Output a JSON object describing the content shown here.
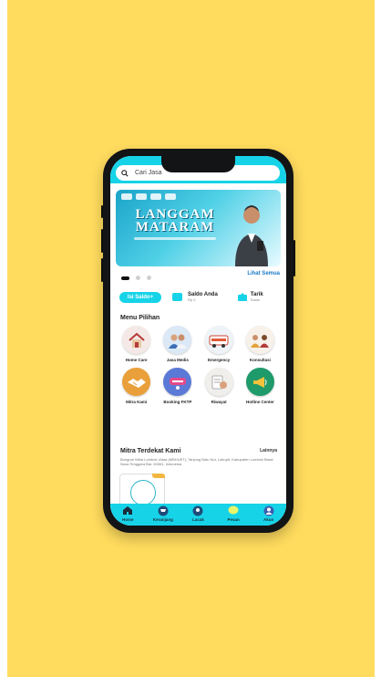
{
  "search": {
    "placeholder": "Cari Jasa"
  },
  "banner": {
    "title_line1": "LANGGAM",
    "title_line2": "MATARAM"
  },
  "carousel": {
    "link": "Lihat Semua",
    "pages": 3,
    "active": 0
  },
  "actions": {
    "topup": "Isi Saldo+",
    "saldo_label": "Saldo Anda",
    "saldo_value": "Rp 0",
    "withdraw_label": "Tarik",
    "withdraw_sub": "Saldo"
  },
  "menu": {
    "title": "Menu Pilihan",
    "items": [
      {
        "label": "Home Care",
        "icon": "house-icon",
        "color": "#f4e9e6"
      },
      {
        "label": "Jasa Medis",
        "icon": "medical-team-icon",
        "color": "#dbe8f6"
      },
      {
        "label": "Emergency",
        "icon": "emergency-icon",
        "color": "#eef3f8"
      },
      {
        "label": "Konsultasi",
        "icon": "consultation-icon",
        "color": "#f7f1ea"
      },
      {
        "label": "Mitra Kami",
        "icon": "handshake-icon",
        "color": "#e9a03a"
      },
      {
        "label": "Booking FKTP",
        "icon": "booking-icon",
        "color": "#5b79d6"
      },
      {
        "label": "Riwayat",
        "icon": "history-icon",
        "color": "#f1efec"
      },
      {
        "label": "Hotline Center",
        "icon": "megaphone-icon",
        "color": "#1f9a6a"
      }
    ]
  },
  "mitra": {
    "title": "Mitra Terdekat Kami",
    "more": "Lainnya",
    "address": "Bungure Mitra Lombok Utara (MBHUET), Tanjung Batu Nur, Lakupit, Kabupaten Lombok Barat Nusa Tenggara Bar. 83361, Indonesia"
  },
  "nav": [
    {
      "label": "Home",
      "icon": "home-icon"
    },
    {
      "label": "Keranjang",
      "icon": "cart-icon"
    },
    {
      "label": "Lacak",
      "icon": "track-icon"
    },
    {
      "label": "Pesan",
      "icon": "chat-icon"
    },
    {
      "label": "Akun",
      "icon": "account-icon"
    }
  ],
  "colors": {
    "accent": "#17D3E8",
    "background": "#FFDC5E",
    "phone": "#121416"
  }
}
